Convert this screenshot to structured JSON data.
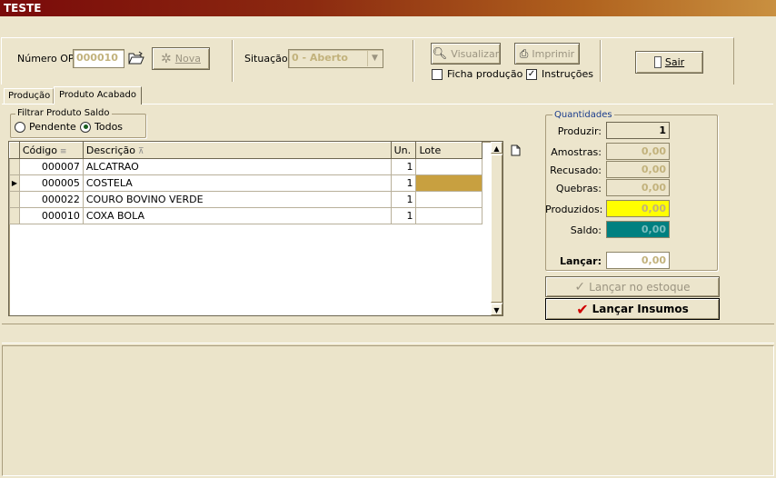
{
  "window": {
    "title": "TESTE"
  },
  "toolbar": {
    "numero_op_label": "Número OP:",
    "numero_op_value": "000010",
    "nova_label": "Nova",
    "situacao_label": "Situação:",
    "situacao_value": "0 - Aberto",
    "visualizar_label": "Visualizar",
    "imprimir_label": "Imprimir",
    "ficha_producao_label": "Ficha produção",
    "ficha_producao_checked": false,
    "instrucoes_label": "Instruções",
    "instrucoes_checked": true,
    "sair_label": "Sair"
  },
  "tabs": [
    {
      "label": "Produção",
      "active": false
    },
    {
      "label": "Produto Acabado",
      "active": true
    }
  ],
  "filter": {
    "title": "Filtrar Produto Saldo",
    "options": [
      "Pendente",
      "Todos"
    ],
    "selected": "Todos"
  },
  "grid": {
    "columns": [
      "Código",
      "Descrição",
      "Un.",
      "Lote"
    ],
    "rows": [
      {
        "codigo": "000007",
        "descricao": "ALCATRAO",
        "un": "1",
        "lote": ""
      },
      {
        "codigo": "000005",
        "descricao": "COSTELA",
        "un": "1",
        "lote": ""
      },
      {
        "codigo": "000022",
        "descricao": "COURO BOVINO VERDE",
        "un": "1",
        "lote": ""
      },
      {
        "codigo": "000010",
        "descricao": "COXA BOLA",
        "un": "1",
        "lote": ""
      }
    ],
    "selected_row": 1
  },
  "quantidades": {
    "title": "Quantidades",
    "produzir_label": "Produzir:",
    "produzir_value": "1",
    "amostras_label": "Amostras:",
    "amostras_value": "0,00",
    "recusado_label": "Recusado:",
    "recusado_value": "0,00",
    "quebras_label": "Quebras:",
    "quebras_value": "0,00",
    "produzidos_label": "Produzidos:",
    "produzidos_value": "0,00",
    "saldo_label": "Saldo:",
    "saldo_value": "0,00",
    "lancar_label": "Lançar:",
    "lancar_value": "0,00"
  },
  "actions": {
    "lancar_estoque_label": "Lançar no estoque",
    "lancar_insumos_label": "Lançar Insumos"
  },
  "colors": {
    "produzidos_bg": "#ffff00",
    "saldo_bg": "#008080",
    "lote_selected_bg": "#c8a040",
    "title_start": "#7a0a0a",
    "check_red": "#d00000"
  }
}
